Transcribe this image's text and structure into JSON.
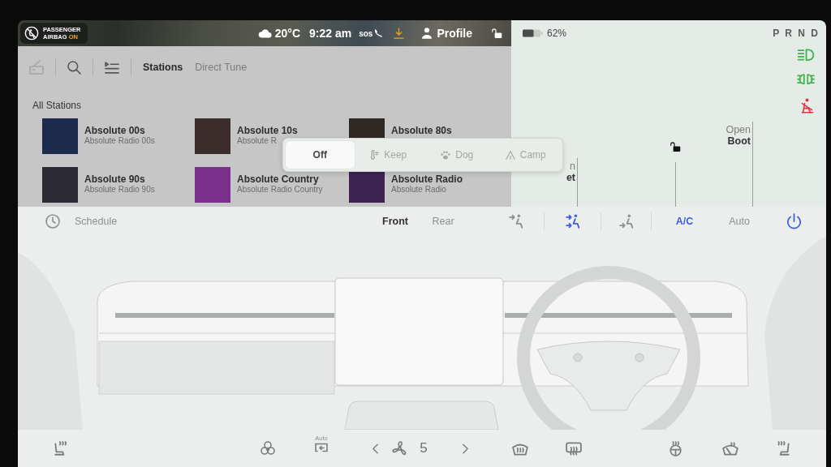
{
  "top_bar": {
    "airbag": {
      "line1": "PASSENGER",
      "line2": "AIRBAG",
      "state": "ON"
    },
    "temperature": "20°C",
    "time": "9:22 am",
    "sos": "sos",
    "profile": "Profile"
  },
  "media": {
    "tabs": [
      {
        "label": "Stations",
        "selected": true
      },
      {
        "label": "Direct Tune",
        "selected": false
      }
    ],
    "section_title": "All Stations",
    "stations": [
      {
        "title": "Absolute 00s",
        "subtitle": "Absolute Radio 00s",
        "color": "#1c2b4c"
      },
      {
        "title": "Absolute 10s",
        "subtitle": "Absolute R",
        "color": "#3b2d2b"
      },
      {
        "title": "Absolute 80s",
        "color": "#2e2924"
      },
      {
        "title": "Absolute 90s",
        "subtitle": "Absolute Radio 90s",
        "color": "#2c2b33"
      },
      {
        "title": "Absolute Country",
        "subtitle": "Absolute Radio Country",
        "color": "#7b2f8c"
      },
      {
        "title": "Absolute Radio",
        "subtitle": "Absolute Radio",
        "color": "#3d2352"
      }
    ]
  },
  "cabin_modes": [
    {
      "label": "Off",
      "selected": true
    },
    {
      "label": "Keep",
      "selected": false
    },
    {
      "label": "Dog",
      "selected": false
    },
    {
      "label": "Camp",
      "selected": false
    }
  ],
  "vehicle": {
    "battery_percent": "62%",
    "gears": "P R N D",
    "partly_hidden_label": [
      "n",
      "et"
    ],
    "boot_button": [
      "Open",
      "Boot"
    ]
  },
  "climate": {
    "schedule": "Schedule",
    "zones": [
      {
        "label": "Front",
        "selected": true
      },
      {
        "label": "Rear",
        "selected": false
      }
    ],
    "airflow": [
      {
        "selected": false
      },
      {
        "selected": true
      },
      {
        "selected": false
      }
    ],
    "ac": {
      "label": "A/C",
      "on": true
    },
    "auto": {
      "label": "Auto",
      "on": false
    },
    "power": {
      "on": true
    }
  },
  "bottom_bar": {
    "recirculate_label": "Auto",
    "fan_speed": "5"
  }
}
